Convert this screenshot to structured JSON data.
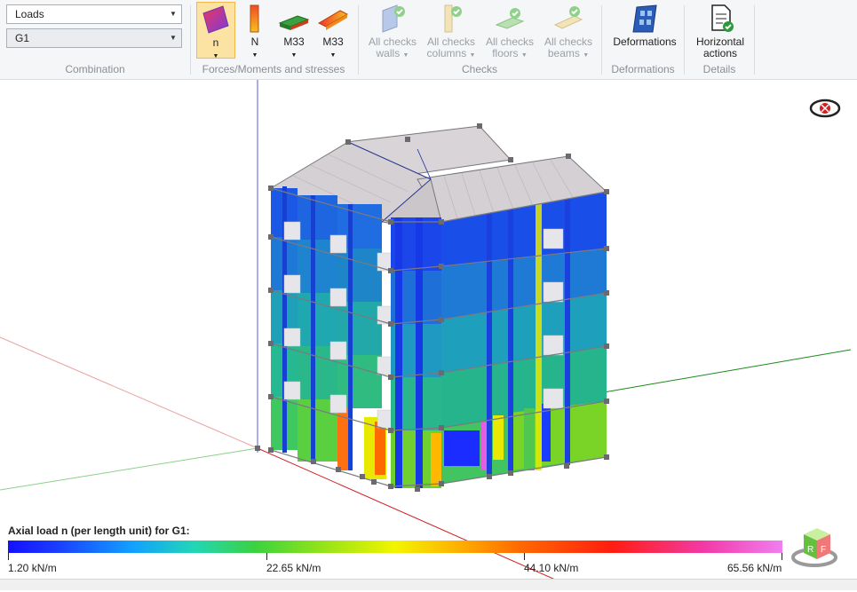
{
  "combination": {
    "load_combo": "Loads",
    "case_combo": "G1",
    "group_label": "Combination"
  },
  "forces": {
    "group_label": "Forces/Moments and stresses",
    "buttons": [
      {
        "label": "n",
        "selected": true
      },
      {
        "label": "N"
      },
      {
        "label": "M33"
      },
      {
        "label": "M33"
      }
    ]
  },
  "checks": {
    "group_label": "Checks",
    "buttons": [
      {
        "line1": "All checks",
        "line2": "walls"
      },
      {
        "line1": "All checks",
        "line2": "columns"
      },
      {
        "line1": "All checks",
        "line2": "floors"
      },
      {
        "line1": "All checks",
        "line2": "beams"
      }
    ]
  },
  "deformations": {
    "group_label": "Deformations",
    "button": "Deformations"
  },
  "details": {
    "group_label": "Details",
    "line1": "Horizontal",
    "line2": "actions"
  },
  "legend": {
    "title": "Axial load n (per length unit) for G1:",
    "ticks": [
      "1.20 kN/m",
      "22.65 kN/m",
      "44.10 kN/m",
      "65.56 kN/m"
    ]
  },
  "colors": {
    "selected_bg": "#fde3a3",
    "ribbon_bg": "#f5f6f7",
    "disabled_text": "#9aa0a6"
  }
}
